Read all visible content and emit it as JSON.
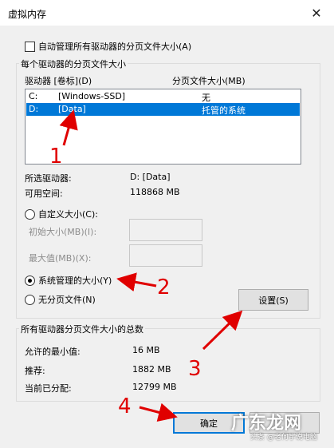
{
  "window": {
    "title": "虚拟内存",
    "close_glyph": "✕"
  },
  "auto_manage": {
    "label": "自动管理所有驱动器的分页文件大小(A)",
    "checked": false
  },
  "per_drive": {
    "group_label": "每个驱动器的分页文件大小",
    "col_drive": "驱动器 [卷标](D)",
    "col_size": "分页文件大小(MB)",
    "rows": [
      {
        "drive": "C:",
        "label": "[Windows-SSD]",
        "size": "无",
        "selected": false
      },
      {
        "drive": "D:",
        "label": "[Data]",
        "size": "托管的系统",
        "selected": true
      }
    ],
    "selected_drive_label": "所选驱动器:",
    "selected_drive_value": "D:  [Data]",
    "free_space_label": "可用空间:",
    "free_space_value": "118868 MB",
    "custom_size_label": "自定义大小(C):",
    "initial_size_label": "初始大小(MB)(I):",
    "max_size_label": "最大值(MB)(X):",
    "system_managed_label": "系统管理的大小(Y)",
    "no_paging_label": "无分页文件(N)",
    "set_button": "设置(S)"
  },
  "totals": {
    "group_label": "所有驱动器分页文件大小的总数",
    "min_label": "允许的最小值:",
    "min_value": "16 MB",
    "recommended_label": "推荐:",
    "recommended_value": "1882 MB",
    "current_label": "当前已分配:",
    "current_value": "12799 MB"
  },
  "buttons": {
    "ok": "确定"
  },
  "annotations": {
    "n1": "1",
    "n2": "2",
    "n3": "3",
    "n4": "4",
    "color": "#e00000"
  },
  "watermark": {
    "big": "广东龙网",
    "small": "头条 @老何学说电脑"
  }
}
